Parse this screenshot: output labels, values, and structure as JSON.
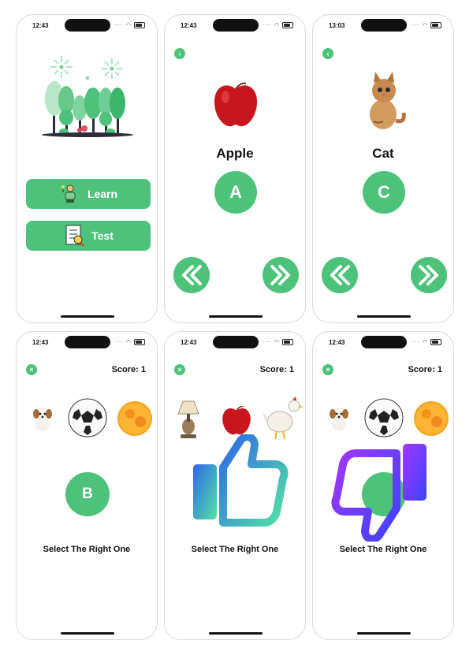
{
  "screens": [
    {
      "time": "12:43",
      "learn_label": "Learn",
      "test_label": "Test"
    },
    {
      "time": "12:43",
      "word": "Apple",
      "letter": "A"
    },
    {
      "time": "13:03",
      "word": "Cat",
      "letter": "C"
    },
    {
      "time": "12:43",
      "score": "Score: 1",
      "letter": "B",
      "prompt": "Select The Right One"
    },
    {
      "time": "12:43",
      "score": "Score: 1",
      "prompt": "Select The Right One"
    },
    {
      "time": "12:43",
      "score": "Score: 1",
      "prompt": "Select The Right One"
    }
  ],
  "colors": {
    "accent": "#4cc27a",
    "thumb_up_start": "#2f68e8",
    "thumb_up_end": "#52e2a4",
    "thumb_down_start": "#a437ff",
    "thumb_down_end": "#3b42ff"
  },
  "icons": {
    "back": "chevron-left-icon",
    "close": "close-icon",
    "prev": "double-chevron-left-icon",
    "next": "double-chevron-right-icon",
    "learn": "teacher-icon",
    "test": "test-sheet-icon"
  }
}
